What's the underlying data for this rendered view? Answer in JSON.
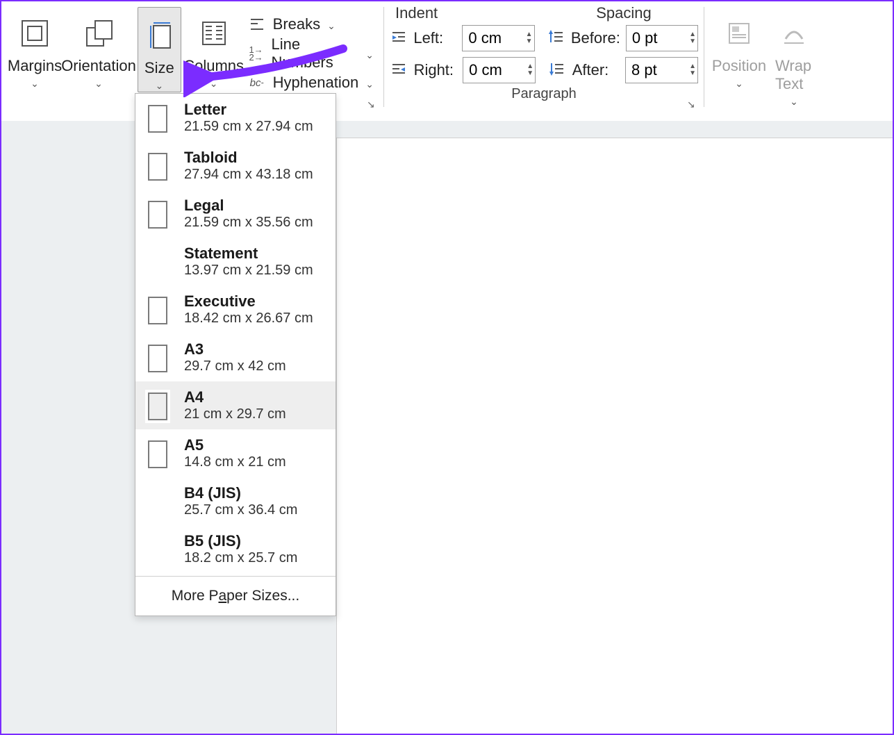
{
  "ribbon": {
    "page_setup": {
      "margins": "Margins",
      "orientation": "Orientation",
      "size": "Size",
      "columns": "Columns",
      "breaks": "Breaks",
      "line_numbers": "Line Numbers",
      "hyphenation": "Hyphenation"
    },
    "paragraph": {
      "group_label": "Paragraph",
      "indent_header": "Indent",
      "spacing_header": "Spacing",
      "left_label": "Left:",
      "right_label": "Right:",
      "before_label": "Before:",
      "after_label": "After:",
      "left_value": "0 cm",
      "right_value": "0 cm",
      "before_value": "0 pt",
      "after_value": "8 pt"
    },
    "arrange": {
      "position": "Position",
      "wrap_text": "Wrap Text"
    }
  },
  "size_menu": {
    "items": [
      {
        "name": "Letter",
        "dims": "21.59 cm x 27.94 cm",
        "icon": true,
        "selected": false
      },
      {
        "name": "Tabloid",
        "dims": "27.94 cm x 43.18 cm",
        "icon": true,
        "selected": false
      },
      {
        "name": "Legal",
        "dims": "21.59 cm x 35.56 cm",
        "icon": true,
        "selected": false
      },
      {
        "name": "Statement",
        "dims": "13.97 cm x 21.59 cm",
        "icon": false,
        "selected": false
      },
      {
        "name": "Executive",
        "dims": "18.42 cm x 26.67 cm",
        "icon": true,
        "selected": false
      },
      {
        "name": "A3",
        "dims": "29.7 cm x 42 cm",
        "icon": true,
        "selected": false
      },
      {
        "name": "A4",
        "dims": "21 cm x 29.7 cm",
        "icon": true,
        "selected": true
      },
      {
        "name": "A5",
        "dims": "14.8 cm x 21 cm",
        "icon": true,
        "selected": false
      },
      {
        "name": "B4 (JIS)",
        "dims": "25.7 cm x 36.4 cm",
        "icon": false,
        "selected": false
      },
      {
        "name": "B5 (JIS)",
        "dims": "18.2 cm x 25.7 cm",
        "icon": false,
        "selected": false
      }
    ],
    "more": "More Paper Sizes..."
  },
  "annotation": {
    "color": "#7b2cff"
  }
}
